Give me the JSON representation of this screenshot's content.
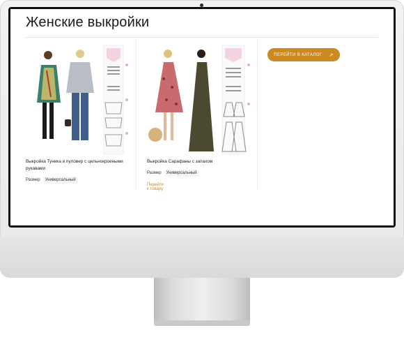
{
  "page": {
    "title": "Женские выкройки"
  },
  "cards": [
    {
      "name": "Выкройка Туника и пуловер с цельнокроеными рукавами",
      "size_label": "Размер",
      "size_value": "Универсальный",
      "link": ""
    },
    {
      "name": "Выкройка Сарафаны с запахом",
      "size_label": "Размер",
      "size_value": "Универсальный",
      "link": "Перейти к товару"
    }
  ],
  "catalog_button": {
    "label": "ПЕРЕЙТИ В КАТАЛОГ",
    "icon": "arrow-up-right-icon"
  },
  "colors": {
    "accent": "#c98a24"
  }
}
